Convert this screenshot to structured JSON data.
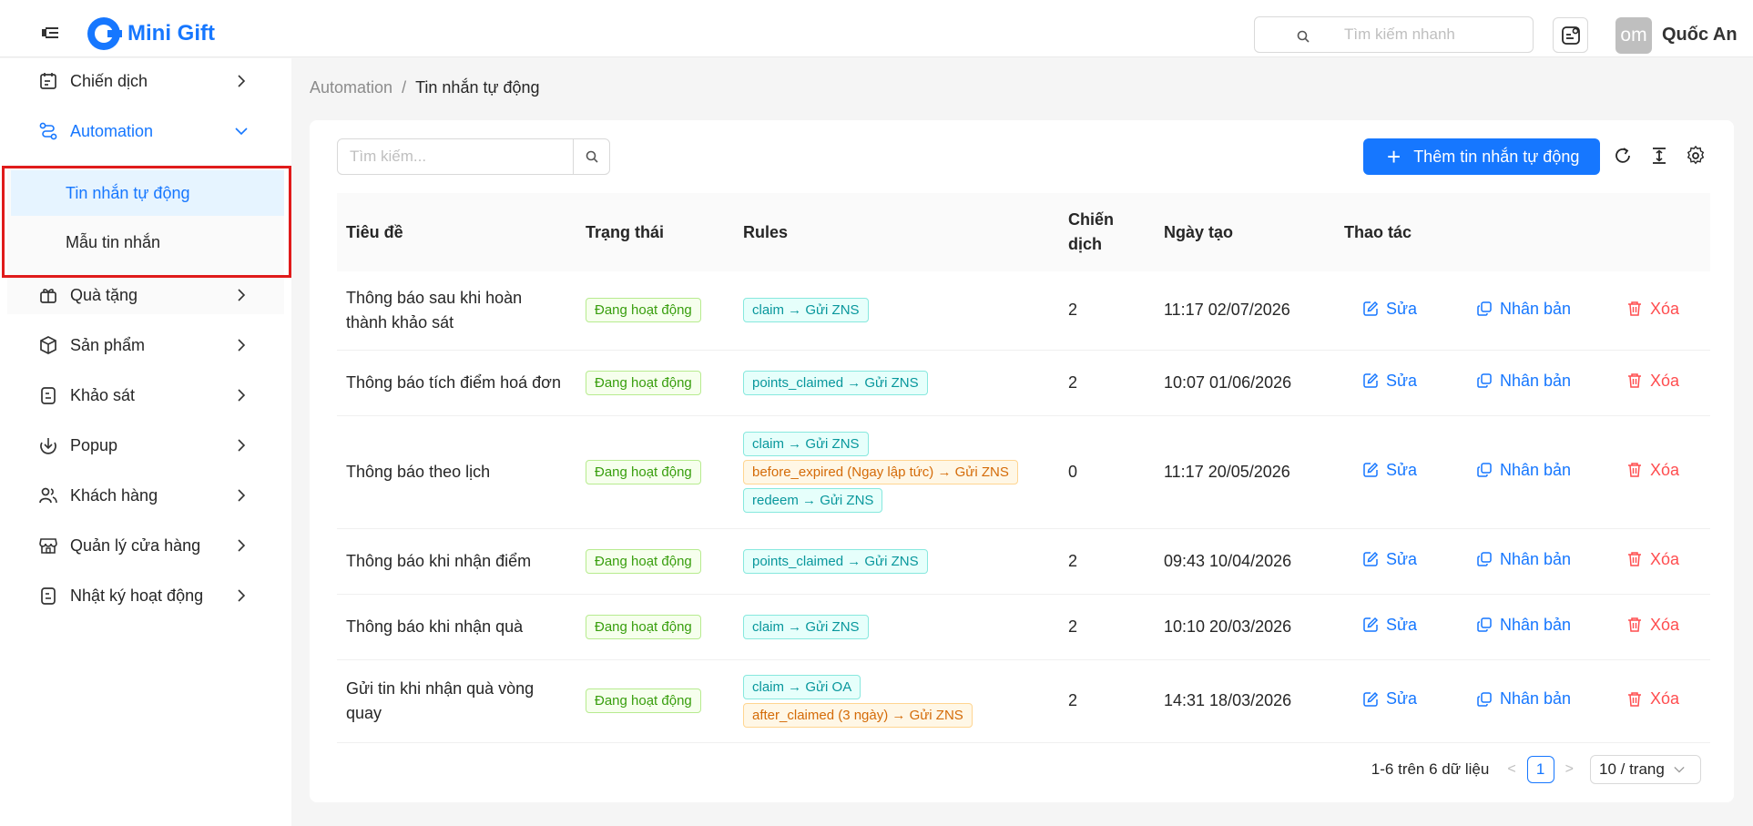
{
  "header": {
    "brand": "Mini Gift",
    "search_placeholder": "Tìm kiếm nhanh",
    "avatar_text": "om",
    "user_name": "Quốc An"
  },
  "sidebar": {
    "items": [
      {
        "label": "Chiến dịch"
      },
      {
        "label": "Automation"
      },
      {
        "label": "Quà tặng"
      },
      {
        "label": "Sản phẩm"
      },
      {
        "label": "Khảo sát"
      },
      {
        "label": "Popup"
      },
      {
        "label": "Khách hàng"
      },
      {
        "label": "Quản lý cửa hàng"
      },
      {
        "label": "Nhật ký hoạt động"
      }
    ],
    "sub_items": [
      {
        "label": "Tin nhắn tự động"
      },
      {
        "label": "Mẫu tin nhắn"
      }
    ]
  },
  "breadcrumb": {
    "parent": "Automation",
    "separator": "/",
    "current": "Tin nhắn tự động"
  },
  "toolbar": {
    "search_placeholder": "Tìm kiếm...",
    "add_label": "Thêm tin nhắn tự động"
  },
  "table": {
    "headers": {
      "title": "Tiêu đề",
      "status": "Trạng thái",
      "rules": "Rules",
      "campaign": "Chiến dịch",
      "created": "Ngày tạo",
      "actions": "Thao tác"
    },
    "actions": {
      "edit": "Sửa",
      "duplicate": "Nhân bản",
      "delete": "Xóa"
    },
    "rows": [
      {
        "title": "Thông báo sau khi hoàn thành khảo sát",
        "status": "Đang hoạt động",
        "rules": [
          {
            "text": "claim → Gửi ZNS",
            "color": "cyan"
          }
        ],
        "campaign": "2",
        "created": "11:17 02/07/2026"
      },
      {
        "title": "Thông báo tích điểm hoá đơn",
        "status": "Đang hoạt động",
        "rules": [
          {
            "text": "points_claimed → Gửi ZNS",
            "color": "cyan"
          }
        ],
        "campaign": "2",
        "created": "10:07 01/06/2026"
      },
      {
        "title": "Thông báo theo lịch",
        "status": "Đang hoạt động",
        "rules": [
          {
            "text": "claim → Gửi ZNS",
            "color": "cyan"
          },
          {
            "text": "before_expired (Ngay lập tức) → Gửi ZNS",
            "color": "orange"
          },
          {
            "text": "redeem → Gửi ZNS",
            "color": "cyan"
          }
        ],
        "campaign": "0",
        "created": "11:17 20/05/2026"
      },
      {
        "title": "Thông báo khi nhận điểm",
        "status": "Đang hoạt động",
        "rules": [
          {
            "text": "points_claimed → Gửi ZNS",
            "color": "cyan"
          }
        ],
        "campaign": "2",
        "created": "09:43 10/04/2026"
      },
      {
        "title": "Thông báo khi nhận quà",
        "status": "Đang hoạt động",
        "rules": [
          {
            "text": "claim → Gửi ZNS",
            "color": "cyan"
          }
        ],
        "campaign": "2",
        "created": "10:10 20/03/2026"
      },
      {
        "title": "Gửi tin khi nhận quà vòng quay",
        "status": "Đang hoạt động",
        "rules": [
          {
            "text": "claim → Gửi OA",
            "color": "cyan"
          },
          {
            "text": "after_claimed (3 ngày) → Gửi ZNS",
            "color": "orange"
          }
        ],
        "campaign": "2",
        "created": "14:31 18/03/2026"
      }
    ]
  },
  "pagination": {
    "summary": "1-6 trên 6 dữ liệu",
    "prev": "<",
    "current_page": "1",
    "next": ">",
    "page_size": "10 / trang"
  }
}
